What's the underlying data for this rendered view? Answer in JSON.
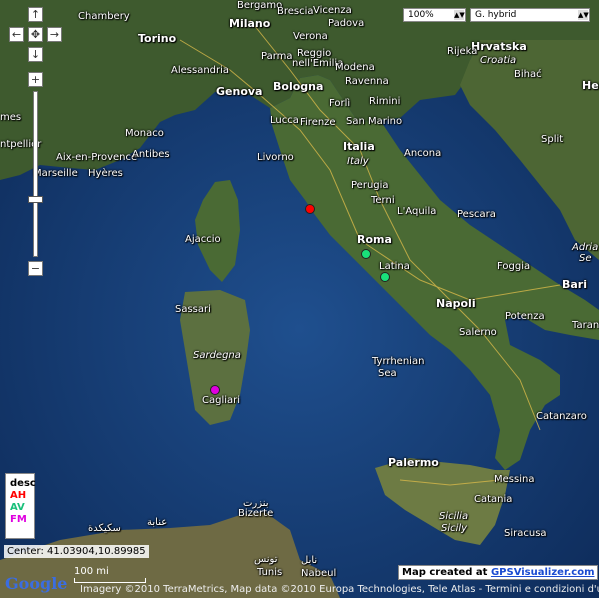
{
  "map_type": {
    "zoom": "100%",
    "layer": "G. hybrid"
  },
  "controls": {
    "pan_up": "↑",
    "pan_down": "↓",
    "pan_left": "←",
    "pan_right": "→",
    "pan_center": "✥",
    "zoom_in": "+",
    "zoom_out": "−"
  },
  "labels": {
    "chambery": "Chambery",
    "bergamo": "Bergamo",
    "brescia": "Brescia",
    "vicenza": "Vicenza",
    "padova": "Padova",
    "milano": "Milano",
    "torino": "Torino",
    "verona": "Verona",
    "parma": "Parma",
    "reggio": "Reggio",
    "emilia": "nell'Emilia",
    "alessandria": "Alessandria",
    "genova": "Genova",
    "bologna": "Bologna",
    "modena": "Modena",
    "ravenna": "Ravenna",
    "forli": "Forlì",
    "rimini": "Rimini",
    "lucca": "Lucca",
    "firenze": "Firenze",
    "san_marino": "San Marino",
    "monaco": "Monaco",
    "aix": "Aix-en-Provence",
    "antibes": "Antibes",
    "marseille": "Marseille",
    "hyeres": "Hyères",
    "italia": "Italia",
    "italy": "Italy",
    "livorno": "Livorno",
    "ancona": "Ancona",
    "perugia": "Perugia",
    "terni": "Terni",
    "laquila": "L'Aquila",
    "pescara": "Pescara",
    "ajaccio": "Ajaccio",
    "roma": "Roma",
    "latina": "Latina",
    "foggia": "Foggia",
    "bari": "Bari",
    "napoli": "Napoli",
    "salerno": "Salerno",
    "potenza": "Potenza",
    "taranto": "Tarant",
    "sassari": "Sassari",
    "sardegna": "Sardegna",
    "tyrrhenian": "Tyrrhenian",
    "sea": "Sea",
    "cagliari": "Cagliari",
    "catanzaro": "Catanzaro",
    "palermo": "Palermo",
    "messina": "Messina",
    "catania": "Catania",
    "sicilia": "Sicilia",
    "sicily": "Sicily",
    "siracusa": "Siracusa",
    "bizerte": "Bizerte",
    "tunis": "Tunis",
    "nabeul": "Nabeul",
    "annaba": "عنابة",
    "skikda": "سكيكدة",
    "bizerte_ar": "بنزرت",
    "tunis_ar": "تونس",
    "nabeul_ar": "نابل",
    "hrvatska": "Hrvatska",
    "croatia": "Croatia",
    "rijeka": "Rijeka",
    "bihac": "Bihać",
    "split": "Split",
    "adria": "Adria",
    "sea2": "Se",
    "her": "Her",
    "mes": "mes",
    "ntpellier": "ntpellier"
  },
  "points": [
    {
      "name": "red",
      "color": "#ff0000"
    },
    {
      "name": "green-roma",
      "color": "#19e07a"
    },
    {
      "name": "green-latina",
      "color": "#19e07a"
    },
    {
      "name": "magenta",
      "color": "#e000e0"
    }
  ],
  "legend": {
    "title": "desc",
    "items": [
      {
        "label": "AH",
        "color": "#ff0000"
      },
      {
        "label": "AV",
        "color": "#19c07a"
      },
      {
        "label": "FM",
        "color": "#e000e0"
      }
    ]
  },
  "center_readout": "Center: 41.03904,10.89985",
  "credit": {
    "prefix": "Map created at ",
    "link": "GPSVisualizer.com"
  },
  "copyright": "Imagery ©2010 TerraMetrics, Map data ©2010 Europa Technologies, Tele Atlas - Termini e condizioni d'uso",
  "scale": "100 mi",
  "google_logo": "Google"
}
